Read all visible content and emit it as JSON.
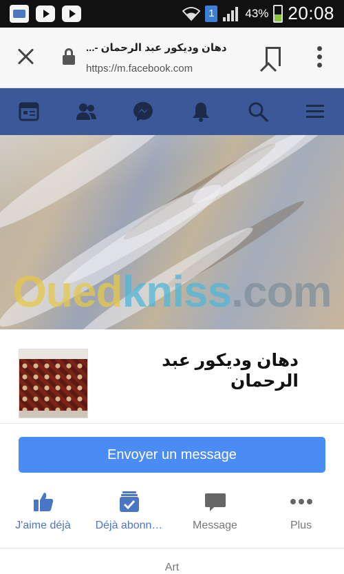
{
  "status_bar": {
    "battery": "43%",
    "sim": "1",
    "time": "20:08"
  },
  "browser": {
    "title": "دهان وديكور عبد الرحمان -...",
    "url": "https://m.facebook.com"
  },
  "fb_nav": {
    "items": [
      "news-feed-icon",
      "friends-icon",
      "messenger-icon",
      "notifications-icon",
      "search-icon",
      "menu-icon"
    ]
  },
  "cover": {
    "watermark": {
      "part1": "Oued",
      "part2": "kniss",
      "part3": ".com"
    }
  },
  "page": {
    "name": "دهان وديكور عبد الرحمان"
  },
  "send_button": {
    "label": "Envoyer un message"
  },
  "actions": [
    {
      "label": "J'aime déjà",
      "icon": "thumbs-up-icon"
    },
    {
      "label": "Déjà abonn…",
      "icon": "subscribed-icon"
    },
    {
      "label": "Message",
      "icon": "message-icon"
    },
    {
      "label": "Plus",
      "icon": "more-icon"
    }
  ],
  "category": "Art",
  "colors": {
    "facebook_blue": "#3b5998",
    "button_blue": "#4b8bf4",
    "action_blue": "#4b76c4"
  }
}
